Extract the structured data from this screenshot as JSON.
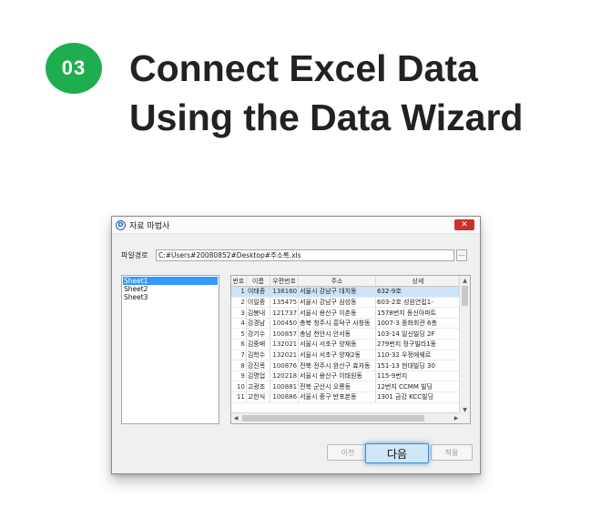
{
  "step": {
    "number": "03"
  },
  "headline": {
    "line1": "Connect Excel Data",
    "line2": "Using the Data Wizard"
  },
  "colors": {
    "badge": "#1fae4f",
    "selection": "#3399ff",
    "close": "#c9312a",
    "next_glow": "#3c8ed6"
  },
  "dialog": {
    "title": "자료 마법사",
    "app_icon": "D",
    "close_symbol": "✕",
    "path_label": "파일경로",
    "path_value": "C:#Users#20080852#Desktop#주소록.xls",
    "browse_label": "···",
    "sheets": [
      "Sheet1",
      "Sheet2",
      "Sheet3"
    ],
    "selected_sheet_index": 0,
    "table": {
      "headers": [
        "번호",
        "이름",
        "우편번호",
        "주소",
        "상세"
      ],
      "rows": [
        [
          "1",
          "이태종",
          "138160",
          "서울시 강남구 대치동",
          "632-9호"
        ],
        [
          "2",
          "이일중",
          "135475",
          "서울시 강남구 삼성동",
          "603-2호 성원연립1-"
        ],
        [
          "3",
          "김봉내",
          "121737",
          "서울시 용산구 이촌동",
          "1578번지 동신아파트"
        ],
        [
          "4",
          "강경남",
          "100450",
          "충북 청주시 흥덕구 사창동",
          "1007-3 중화회관 6층"
        ],
        [
          "5",
          "강기수",
          "100857",
          "충남 천안시 안서동",
          "103-14 일신빌딩 2F"
        ],
        [
          "6",
          "김중배",
          "132021",
          "서울시 서초구 양재동",
          "279번지 정구빌라1동"
        ],
        [
          "7",
          "김학수",
          "132021",
          "서울시 서초구 양재2동",
          "110-32 우정에쉐르"
        ],
        [
          "8",
          "강진목",
          "100876",
          "전북 전주시 완산구 효자동",
          "151-13 현대빌딩 30"
        ],
        [
          "9",
          "김명업",
          "120218",
          "서울시 용산구 이태원동",
          "115-9번지"
        ],
        [
          "10",
          "고광조",
          "100881",
          "전북 군산시 오룡동",
          "12번지 CCMM 빌딩"
        ],
        [
          "11",
          "고한식",
          "100886",
          "서울시 중구 반포본동",
          "1301 금강 KCC빌딩"
        ]
      ],
      "selected_row_index": 0
    },
    "buttons": {
      "prev": "이전",
      "next": "다음",
      "apply": "적용"
    }
  }
}
